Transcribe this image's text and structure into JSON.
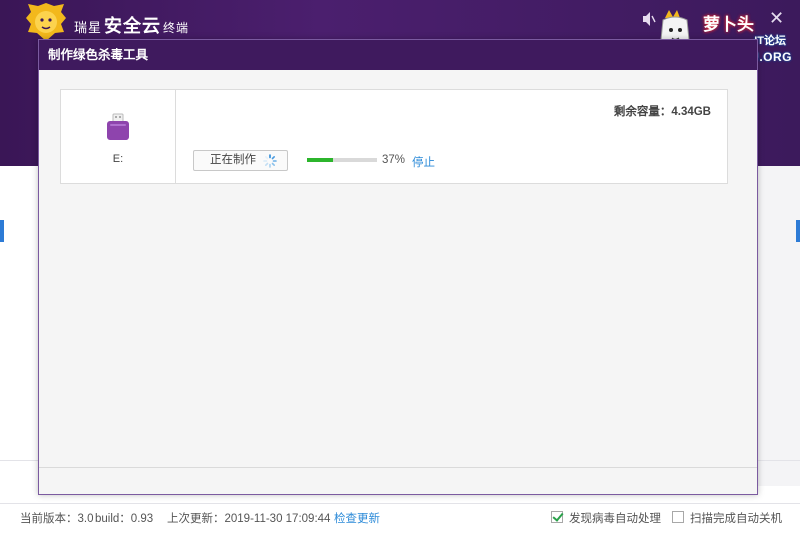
{
  "app": {
    "brand_prefix": "瑞星",
    "brand_main": "安全云",
    "brand_suffix": "终端"
  },
  "window_controls": {
    "close": "✕"
  },
  "watermark": {
    "name_cn": "萝卜头",
    "tag": "IT论坛",
    "url": "BBS.LUOBOTOU.ORG"
  },
  "dialog": {
    "title": "制作绿色杀毒工具",
    "drive_label": "E:",
    "capacity": "剩余容量：4.34GB",
    "make_button": "正在制作",
    "progress_percent": 37,
    "progress_text": "37%",
    "stop_link": "停止"
  },
  "status_bar": {
    "version": "当前版本：3.0",
    "build": "build：0.93",
    "last_update": "上次更新：2019-11-30 17:09:44",
    "check_update": "检查更新",
    "auto_handle_virus": "发现病毒自动处理",
    "auto_shutdown": "扫描完成自动关机"
  },
  "colors": {
    "header": "#3f1a5e",
    "accent_link": "#2b8ad8",
    "progress": "#2cb52c",
    "usb_icon": "#8e44ad"
  },
  "icons": [
    "lion-logo-icon",
    "mute-icon",
    "close-icon",
    "usb-drive-icon",
    "loading-spinner-icon",
    "checkbox-icon"
  ]
}
